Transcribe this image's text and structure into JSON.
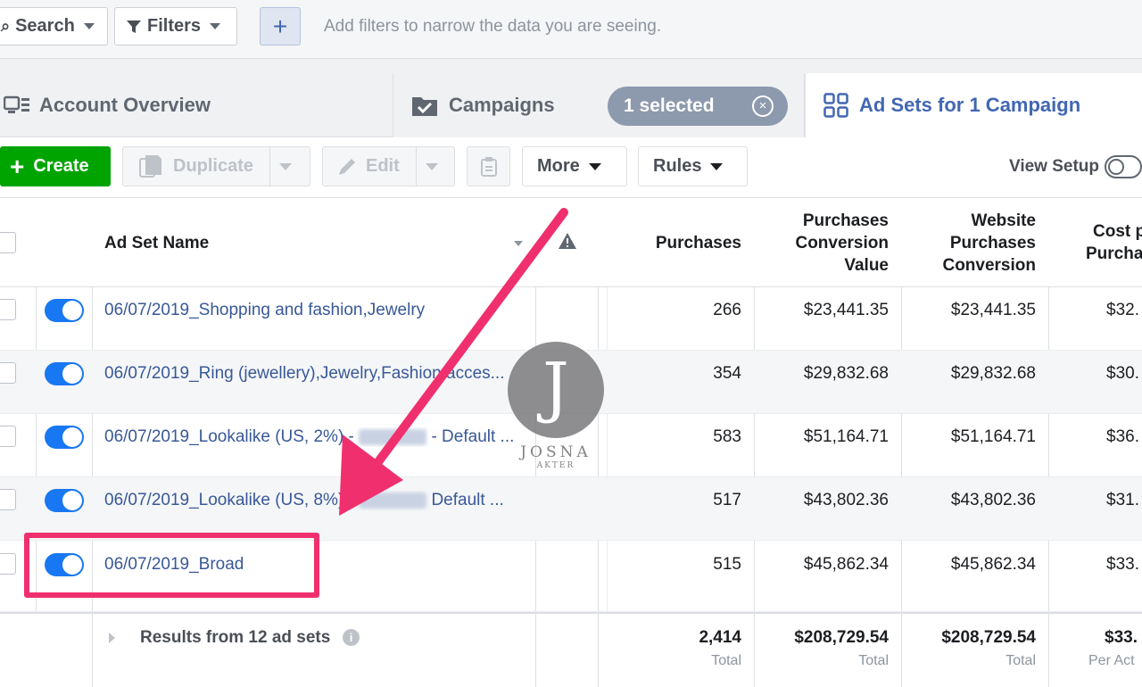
{
  "filter_bar": {
    "search_label": "Search",
    "filters_label": "Filters",
    "add_label": "+",
    "hint": "Add filters to narrow the data you are seeing."
  },
  "tabs": {
    "account_overview": "Account Overview",
    "campaigns": "Campaigns",
    "selected_pill": "1 selected",
    "selected_clear": "×",
    "ad_sets": "Ad Sets for 1 Campaign"
  },
  "toolbar": {
    "create": "Create",
    "duplicate": "Duplicate",
    "edit": "Edit",
    "more": "More",
    "rules": "Rules",
    "view_setup": "View Setup"
  },
  "table": {
    "headers": {
      "name": "Ad Set Name",
      "purchases": "Purchases",
      "conv_value": [
        "Purchases",
        "Conversion",
        "Value"
      ],
      "website": [
        "Website",
        "Purchases",
        "Conversion"
      ],
      "cost": [
        "Cost p",
        "Purcha"
      ]
    },
    "rows": [
      {
        "name": "06/07/2019_Shopping and fashion,Jewelry",
        "purchases": "266",
        "value": "$23,441.35",
        "website": "$23,441.35",
        "cost": "$32."
      },
      {
        "name": "06/07/2019_Ring (jewellery),Jewelry,Fashion acces...",
        "purchases": "354",
        "value": "$29,832.68",
        "website": "$29,832.68",
        "cost": "$30."
      },
      {
        "name_pre": "06/07/2019_Lookalike (US, 2%) -",
        "name_post": "- Default ...",
        "purchases": "583",
        "value": "$51,164.71",
        "website": "$51,164.71",
        "cost": "$36."
      },
      {
        "name_pre": "06/07/2019_Lookalike (US, 8%) -",
        "name_post": "Default ...",
        "purchases": "517",
        "value": "$43,802.36",
        "website": "$43,802.36",
        "cost": "$31."
      },
      {
        "name": "06/07/2019_Broad",
        "purchases": "515",
        "value": "$45,862.34",
        "website": "$45,862.34",
        "cost": "$33."
      }
    ],
    "footer": {
      "results": "Results from 12 ad sets",
      "purchases": "2,414",
      "purchases_sub": "Total",
      "value": "$208,729.54",
      "value_sub": "Total",
      "website": "$208,729.54",
      "website_sub": "Total",
      "cost": "$33.",
      "cost_sub": "Per Act"
    }
  },
  "watermark": {
    "letter": "J",
    "name": "JOSNA",
    "sub": "AKTER"
  },
  "colors": {
    "accent": "#4267b2",
    "create": "#00a400",
    "toggle_on": "#1877f2",
    "highlight": "#f0306e"
  }
}
